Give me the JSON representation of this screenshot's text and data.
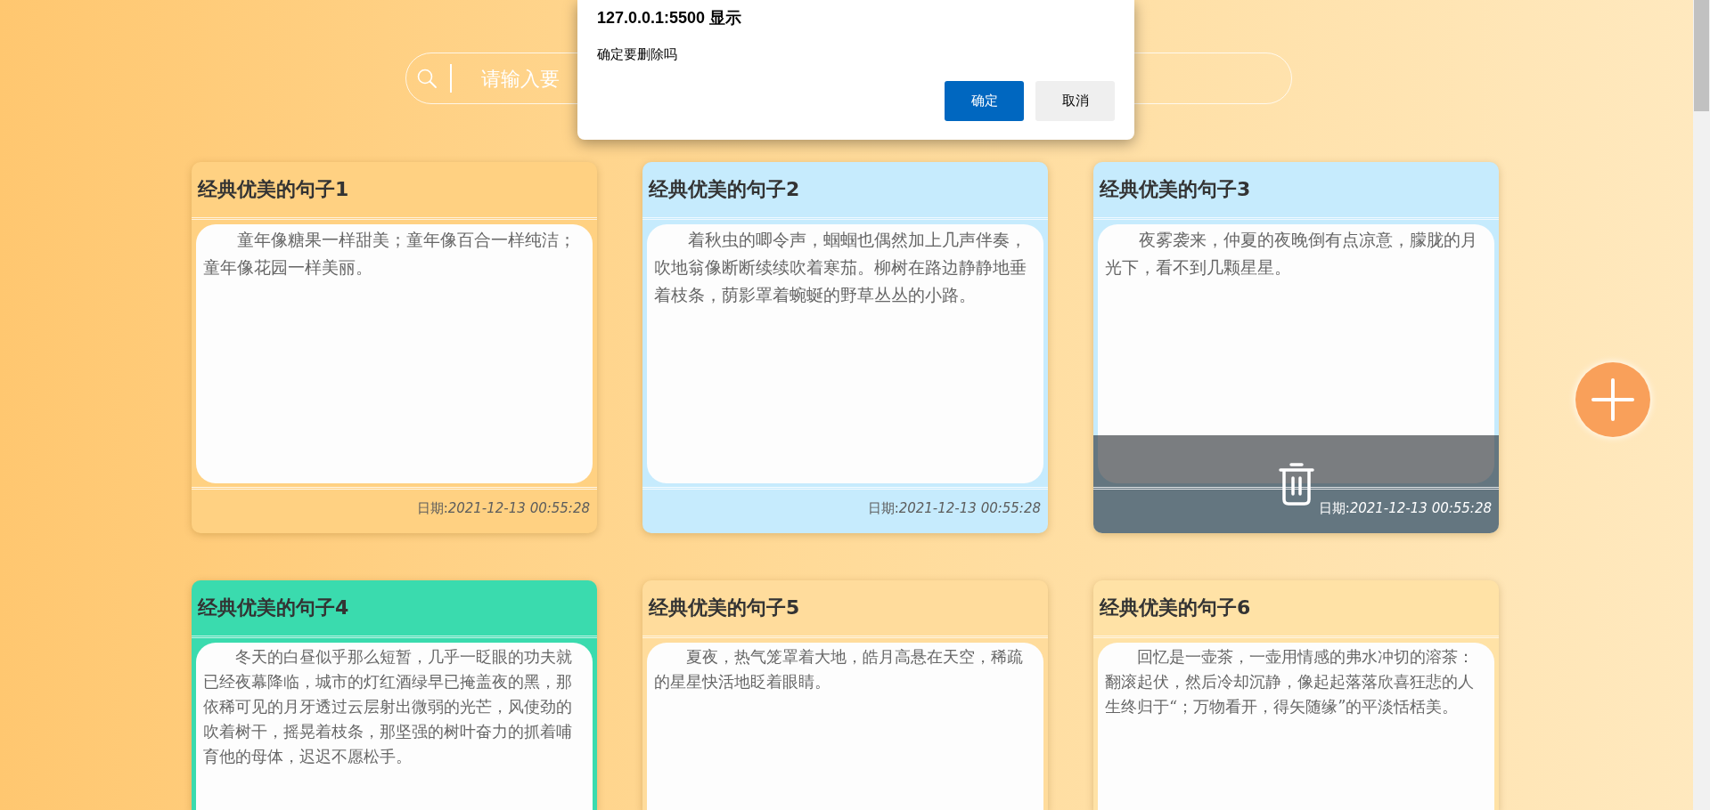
{
  "search": {
    "placeholder": "请输入要"
  },
  "cards": [
    {
      "title": "经典优美的句子1",
      "text": "童年像糖果一样甜美；童年像百合一样纯洁；童年像花园一样美丽。",
      "date": "日期:*2021-12-13 00:55:28*",
      "color": "#ffd182",
      "delete_overlay": false
    },
    {
      "title": "经典优美的句子2",
      "text": "着秋虫的唧令声，蝈蝈也偶然加上几声伴奏，吹地翁像断断续续吹着寒茄。柳树在路边静静地垂着枝条，荫影罩着蜿蜒的野草丛丛的小路。",
      "date": "日期:*2021-12-13 00:55:28*",
      "color": "#c6ebfd",
      "delete_overlay": false
    },
    {
      "title": "经典优美的句子3",
      "text": "夜雾袭来，仲夏的夜晚倒有点凉意，朦胧的月光下，看不到几颗星星。",
      "date": "日期:*2021-12-13 00:55:28*",
      "color": "#c6ebfd",
      "delete_overlay": true
    },
    {
      "title": "经典优美的句子4",
      "text": "冬天的白昼似乎那么短暂，几乎一眨眼的功夫就已经夜幕降临，城市的灯红酒绿早已掩盖夜的黑，那依稀可见的月牙透过云层射出微弱的光芒，风使劲的吹着树干，摇晃着枝条，那坚强的树叶奋力的抓着哺育他的母体，迟迟不愿松手。",
      "color": "#3adbae",
      "delete_overlay": false
    },
    {
      "title": "经典优美的句子5",
      "text": "夏夜，热气笼罩着大地，皓月高悬在天空，稀疏的星星快活地眨着眼睛。",
      "color": "#ffdc9c",
      "delete_overlay": false
    },
    {
      "title": "经典优美的句子6",
      "text": "回忆是一壶茶，一壶用情感的弗水冲切的溶茶：翻滚起伏，然后冷却沉静，像起起落落欣喜狂悲的人生终归于“；万物看开，得矢随缘”的平淡恬栝美。",
      "color": "#ffe2a6",
      "delete_overlay": false
    }
  ],
  "dialog": {
    "title": "127.0.0.1:5500 显示",
    "message": "确定要删除吗",
    "buttons": [
      {
        "label": "确定",
        "kind": "primary"
      },
      {
        "label": "取消",
        "kind": "secondary"
      }
    ]
  }
}
